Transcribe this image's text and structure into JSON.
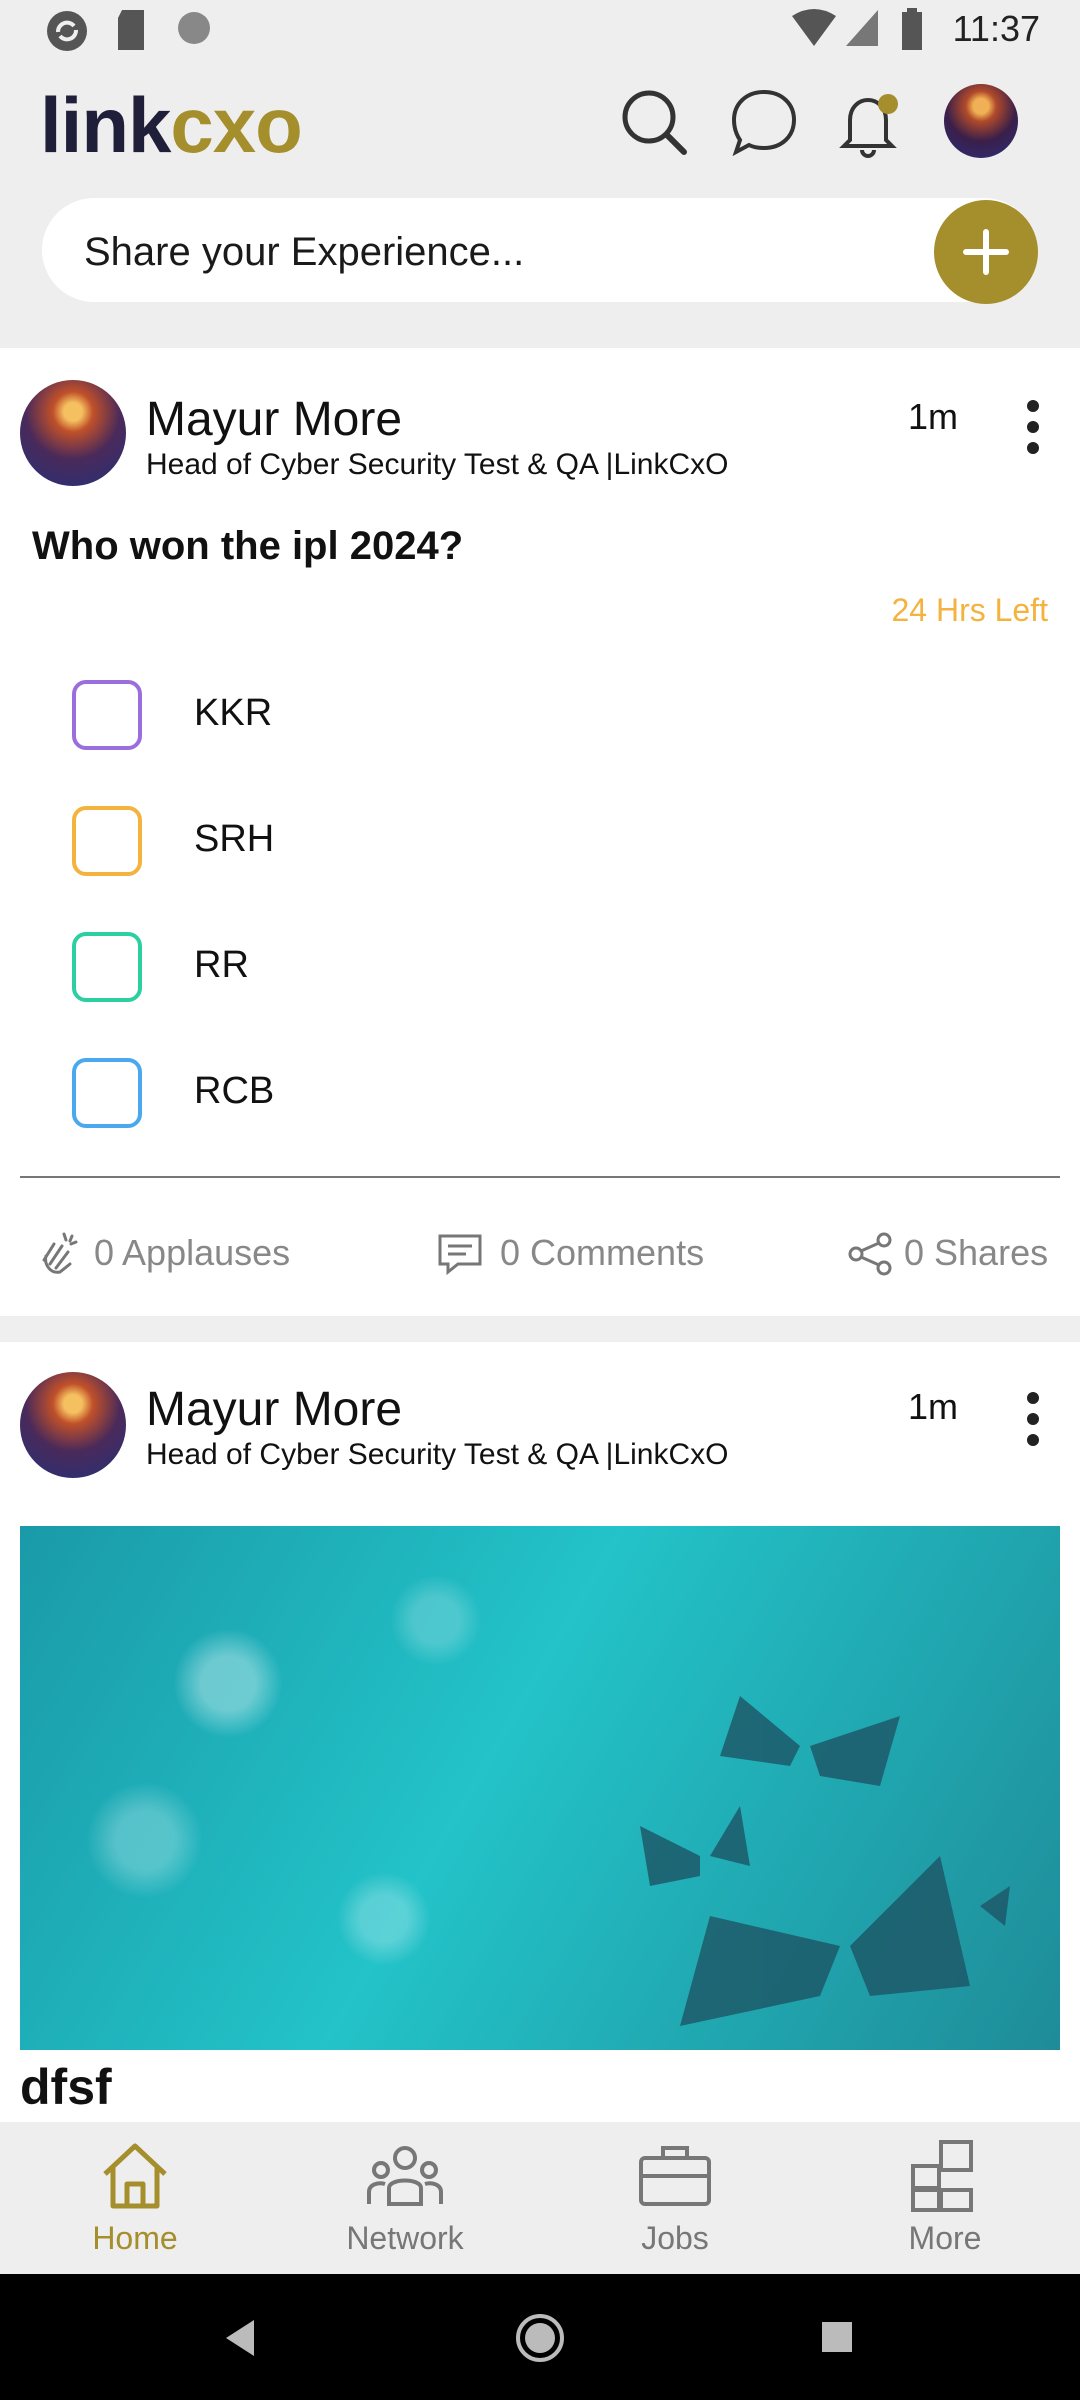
{
  "status_bar": {
    "time": "11:37"
  },
  "header": {
    "logo_part1": "link",
    "logo_part2": "cxo",
    "share_placeholder": "Share your Experience..."
  },
  "posts": [
    {
      "author": "Mayur More",
      "title": "Head of Cyber Security Test & QA |LinkCxO",
      "time": "1m",
      "question": "Who won the ipl 2024?",
      "time_left": "24 Hrs Left",
      "options": [
        {
          "label": "KKR",
          "color": "#9b6ee0"
        },
        {
          "label": "SRH",
          "color": "#f4b23f"
        },
        {
          "label": "RR",
          "color": "#2ccf9f"
        },
        {
          "label": "RCB",
          "color": "#4aa9ee"
        }
      ],
      "stats": {
        "applauses": "0 Applauses",
        "comments": "0 Comments",
        "shares": "0 Shares"
      }
    },
    {
      "author": "Mayur More",
      "title": "Head of Cyber Security Test & QA |LinkCxO",
      "time": "1m",
      "text": "dfsf"
    }
  ],
  "bottom_nav": [
    {
      "label": "Home",
      "active": true
    },
    {
      "label": "Network",
      "active": false
    },
    {
      "label": "Jobs",
      "active": false
    },
    {
      "label": "More",
      "active": false
    }
  ],
  "colors": {
    "brand_gold": "#a58e2c",
    "brand_navy": "#1f1f3a",
    "deadline": "#f4b23f",
    "inactive_nav": "#777777"
  }
}
